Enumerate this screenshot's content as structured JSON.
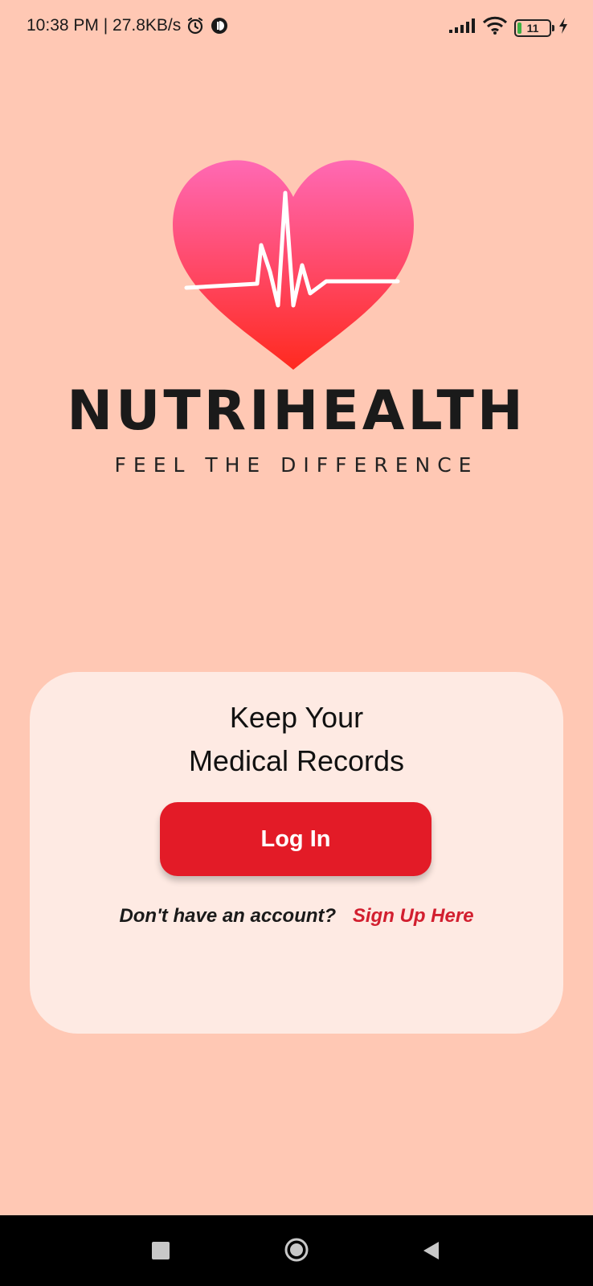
{
  "status_bar": {
    "time_speed": "10:38 PM | 27.8KB/s",
    "battery_level": "11"
  },
  "brand": {
    "name": "NUTRIHEALTH",
    "tagline": "FEEL THE DIFFERENCE",
    "colors": {
      "heart_top": "#FF69B4",
      "heart_bottom": "#FF2A1F",
      "background": "#FFC8B4"
    }
  },
  "card": {
    "headline_line1": "Keep Your",
    "headline_line2": "Medical Records",
    "login_label": "Log In",
    "signup_prompt": "Don't have an account?",
    "signup_link": "Sign Up Here"
  },
  "nav": {
    "icons": [
      "recents-icon",
      "home-icon",
      "back-icon"
    ]
  }
}
